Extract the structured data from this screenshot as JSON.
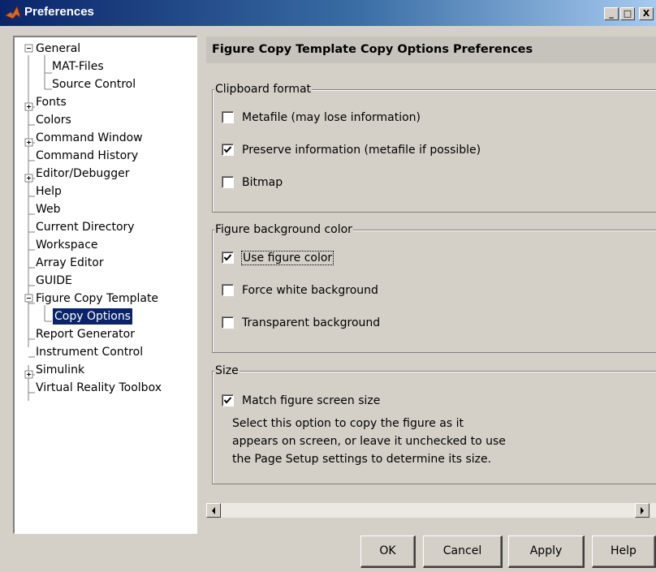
{
  "window": {
    "title": "Preferences",
    "controls": {
      "minimize": "_",
      "maximize": "□",
      "close": "X"
    }
  },
  "tree": {
    "items": [
      {
        "label": "General",
        "expander": "minus"
      },
      {
        "label": "MAT-Files"
      },
      {
        "label": "Source Control"
      },
      {
        "label": "Fonts",
        "expander": "plus"
      },
      {
        "label": "Colors"
      },
      {
        "label": "Command Window",
        "expander": "plus"
      },
      {
        "label": "Command History"
      },
      {
        "label": "Editor/Debugger",
        "expander": "plus"
      },
      {
        "label": "Help"
      },
      {
        "label": "Web"
      },
      {
        "label": "Current Directory"
      },
      {
        "label": "Workspace"
      },
      {
        "label": "Array Editor"
      },
      {
        "label": "GUIDE"
      },
      {
        "label": "Figure Copy Template",
        "expander": "minus"
      },
      {
        "label": "Copy Options",
        "selected": true
      },
      {
        "label": "Report Generator"
      },
      {
        "label": "Instrument Control"
      },
      {
        "label": "Simulink",
        "expander": "plus"
      },
      {
        "label": "Virtual Reality Toolbox"
      }
    ]
  },
  "panel": {
    "header": "Figure Copy Template Copy Options Preferences",
    "clipboard": {
      "legend": "Clipboard format",
      "options": [
        {
          "label": "Metafile (may lose information)",
          "checked": false
        },
        {
          "label": "Preserve information (metafile if possible)",
          "checked": true
        },
        {
          "label": "Bitmap",
          "checked": false
        }
      ]
    },
    "background": {
      "legend": "Figure background color",
      "options": [
        {
          "label": "Use figure color",
          "checked": true
        },
        {
          "label": "Force white background",
          "checked": false
        },
        {
          "label": "Transparent background",
          "checked": false
        }
      ]
    },
    "size": {
      "legend": "Size",
      "match_label": "Match figure screen size",
      "match_checked": true,
      "description": [
        "Select this option to copy the figure as it",
        "appears on screen, or leave it unchecked to use",
        "the Page Setup settings to determine its size."
      ]
    }
  },
  "buttons": {
    "ok": "OK",
    "cancel": "Cancel",
    "apply": "Apply",
    "help": "Help"
  },
  "icons": {
    "app": "matlab-logo-icon",
    "scroll_left": "arrow-left-icon",
    "scroll_right": "arrow-right-icon",
    "check": "checkmark-icon"
  },
  "colors": {
    "selection": "#0a246a",
    "titlebar_start": "#0a246a",
    "titlebar_end": "#a6caf0",
    "dialog_bg": "#d4d0c8"
  }
}
